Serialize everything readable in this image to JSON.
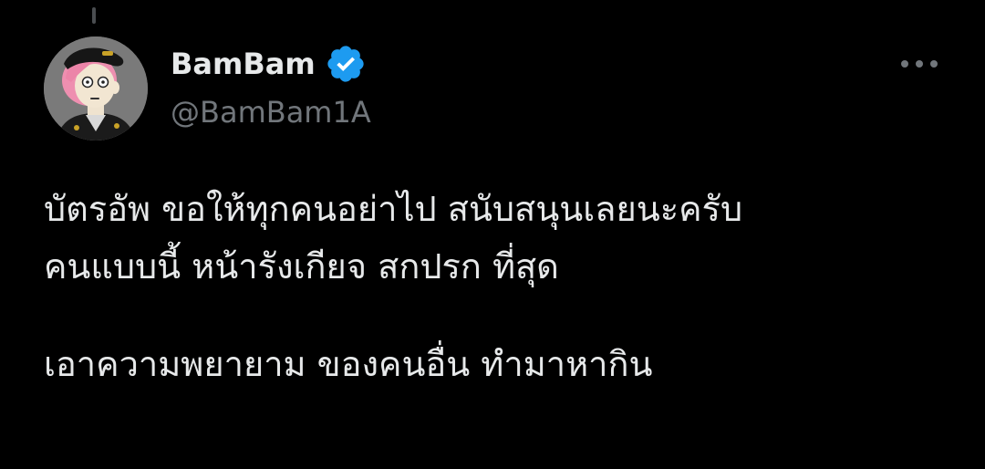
{
  "tweet": {
    "author": {
      "display_name": "BamBam",
      "handle": "@BamBam1A",
      "verified": true,
      "verified_icon": "verified-badge-icon",
      "avatar_icon": "cartoon-avatar"
    },
    "more_icon": "more-horizontal-icon",
    "text_lines": [
      "บัตรอัพ ขอให้ทุกคนอย่าไป สนับสนุนเลยนะครับ",
      "คนแบบนี้ หน้ารังเกียจ สกปรก ที่สุด",
      "เอาความพยายาม ของคนอื่น ทำมาหากิน"
    ]
  },
  "colors": {
    "background": "#000000",
    "primary_text": "#e7e9ea",
    "secondary_text": "#71767b",
    "verified_blue": "#1d9bf0"
  }
}
